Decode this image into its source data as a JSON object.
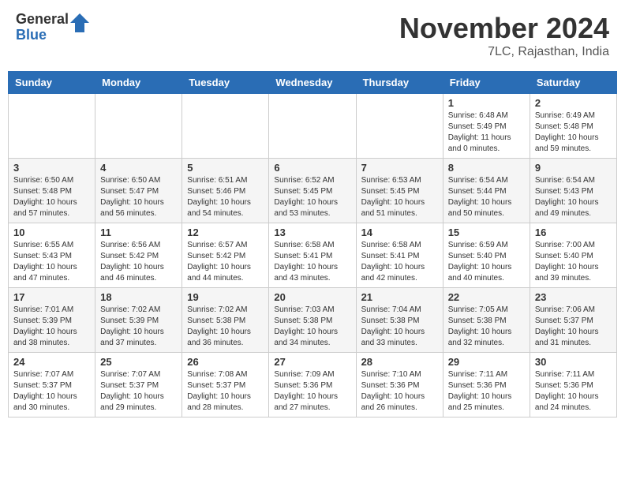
{
  "header": {
    "logo_general": "General",
    "logo_blue": "Blue",
    "month_title": "November 2024",
    "location": "7LC, Rajasthan, India"
  },
  "calendar": {
    "headers": [
      "Sunday",
      "Monday",
      "Tuesday",
      "Wednesday",
      "Thursday",
      "Friday",
      "Saturday"
    ],
    "weeks": [
      [
        {
          "day": "",
          "info": ""
        },
        {
          "day": "",
          "info": ""
        },
        {
          "day": "",
          "info": ""
        },
        {
          "day": "",
          "info": ""
        },
        {
          "day": "",
          "info": ""
        },
        {
          "day": "1",
          "info": "Sunrise: 6:48 AM\nSunset: 5:49 PM\nDaylight: 11 hours and 0 minutes."
        },
        {
          "day": "2",
          "info": "Sunrise: 6:49 AM\nSunset: 5:48 PM\nDaylight: 10 hours and 59 minutes."
        }
      ],
      [
        {
          "day": "3",
          "info": "Sunrise: 6:50 AM\nSunset: 5:48 PM\nDaylight: 10 hours and 57 minutes."
        },
        {
          "day": "4",
          "info": "Sunrise: 6:50 AM\nSunset: 5:47 PM\nDaylight: 10 hours and 56 minutes."
        },
        {
          "day": "5",
          "info": "Sunrise: 6:51 AM\nSunset: 5:46 PM\nDaylight: 10 hours and 54 minutes."
        },
        {
          "day": "6",
          "info": "Sunrise: 6:52 AM\nSunset: 5:45 PM\nDaylight: 10 hours and 53 minutes."
        },
        {
          "day": "7",
          "info": "Sunrise: 6:53 AM\nSunset: 5:45 PM\nDaylight: 10 hours and 51 minutes."
        },
        {
          "day": "8",
          "info": "Sunrise: 6:54 AM\nSunset: 5:44 PM\nDaylight: 10 hours and 50 minutes."
        },
        {
          "day": "9",
          "info": "Sunrise: 6:54 AM\nSunset: 5:43 PM\nDaylight: 10 hours and 49 minutes."
        }
      ],
      [
        {
          "day": "10",
          "info": "Sunrise: 6:55 AM\nSunset: 5:43 PM\nDaylight: 10 hours and 47 minutes."
        },
        {
          "day": "11",
          "info": "Sunrise: 6:56 AM\nSunset: 5:42 PM\nDaylight: 10 hours and 46 minutes."
        },
        {
          "day": "12",
          "info": "Sunrise: 6:57 AM\nSunset: 5:42 PM\nDaylight: 10 hours and 44 minutes."
        },
        {
          "day": "13",
          "info": "Sunrise: 6:58 AM\nSunset: 5:41 PM\nDaylight: 10 hours and 43 minutes."
        },
        {
          "day": "14",
          "info": "Sunrise: 6:58 AM\nSunset: 5:41 PM\nDaylight: 10 hours and 42 minutes."
        },
        {
          "day": "15",
          "info": "Sunrise: 6:59 AM\nSunset: 5:40 PM\nDaylight: 10 hours and 40 minutes."
        },
        {
          "day": "16",
          "info": "Sunrise: 7:00 AM\nSunset: 5:40 PM\nDaylight: 10 hours and 39 minutes."
        }
      ],
      [
        {
          "day": "17",
          "info": "Sunrise: 7:01 AM\nSunset: 5:39 PM\nDaylight: 10 hours and 38 minutes."
        },
        {
          "day": "18",
          "info": "Sunrise: 7:02 AM\nSunset: 5:39 PM\nDaylight: 10 hours and 37 minutes."
        },
        {
          "day": "19",
          "info": "Sunrise: 7:02 AM\nSunset: 5:38 PM\nDaylight: 10 hours and 36 minutes."
        },
        {
          "day": "20",
          "info": "Sunrise: 7:03 AM\nSunset: 5:38 PM\nDaylight: 10 hours and 34 minutes."
        },
        {
          "day": "21",
          "info": "Sunrise: 7:04 AM\nSunset: 5:38 PM\nDaylight: 10 hours and 33 minutes."
        },
        {
          "day": "22",
          "info": "Sunrise: 7:05 AM\nSunset: 5:38 PM\nDaylight: 10 hours and 32 minutes."
        },
        {
          "day": "23",
          "info": "Sunrise: 7:06 AM\nSunset: 5:37 PM\nDaylight: 10 hours and 31 minutes."
        }
      ],
      [
        {
          "day": "24",
          "info": "Sunrise: 7:07 AM\nSunset: 5:37 PM\nDaylight: 10 hours and 30 minutes."
        },
        {
          "day": "25",
          "info": "Sunrise: 7:07 AM\nSunset: 5:37 PM\nDaylight: 10 hours and 29 minutes."
        },
        {
          "day": "26",
          "info": "Sunrise: 7:08 AM\nSunset: 5:37 PM\nDaylight: 10 hours and 28 minutes."
        },
        {
          "day": "27",
          "info": "Sunrise: 7:09 AM\nSunset: 5:36 PM\nDaylight: 10 hours and 27 minutes."
        },
        {
          "day": "28",
          "info": "Sunrise: 7:10 AM\nSunset: 5:36 PM\nDaylight: 10 hours and 26 minutes."
        },
        {
          "day": "29",
          "info": "Sunrise: 7:11 AM\nSunset: 5:36 PM\nDaylight: 10 hours and 25 minutes."
        },
        {
          "day": "30",
          "info": "Sunrise: 7:11 AM\nSunset: 5:36 PM\nDaylight: 10 hours and 24 minutes."
        }
      ]
    ]
  }
}
